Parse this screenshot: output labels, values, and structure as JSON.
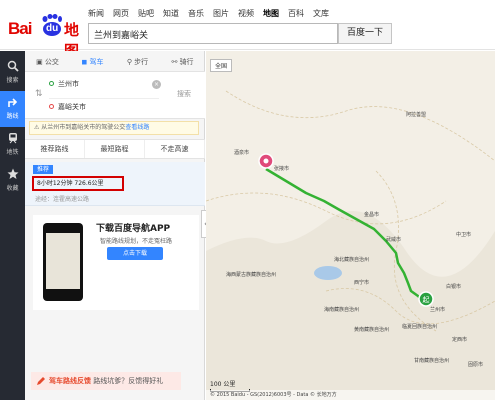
{
  "header": {
    "logo_bai": "Bai",
    "logo_du": "du",
    "logo_map": "地图",
    "nav": [
      "新闻",
      "网页",
      "贴吧",
      "知道",
      "音乐",
      "图片",
      "视频",
      "地图",
      "百科",
      "文库"
    ],
    "search_value": "兰州到嘉峪关",
    "search_button": "百度一下"
  },
  "sidebar": {
    "items": [
      {
        "label": "搜索",
        "icon": "search-icon"
      },
      {
        "label": "路线",
        "icon": "route-icon"
      },
      {
        "label": "地铁",
        "icon": "subway-icon"
      },
      {
        "label": "收藏",
        "icon": "star-icon"
      }
    ]
  },
  "panel": {
    "modes": [
      "公交",
      "驾车",
      "步行",
      "骑行"
    ],
    "start": "兰州市",
    "end": "嘉峪关市",
    "search_link": "搜索",
    "tip_text": "从兰州市到嘉峪关市的驾驶公交",
    "tip_link": "查看线路",
    "options": [
      "推荐路线",
      "最短路程",
      "不走高速"
    ],
    "result_badge": "推荐",
    "duration": "8小时12分钟",
    "distance": "726.6公里",
    "via": "途经：连霍高速公路"
  },
  "ad": {
    "title": "下载百度导航APP",
    "subtitle": "智能路线规划，不走冤枉路",
    "button": "点击下载"
  },
  "feedback": {
    "label": "驾车路线反馈",
    "text": "路线坑爹？反馈得好礼"
  },
  "map": {
    "full_button": "全国",
    "scale": "100 公里",
    "copyright": "© 2015 Baidu - GS(2012)6003号 - Data © 长地万方",
    "labels": [
      "张掖市",
      "酒泉市",
      "金昌市",
      "武威市",
      "西宁市",
      "兰州市",
      "白银市",
      "定西市",
      "海北藏族自治州",
      "海南藏族自治州",
      "黄南藏族自治州",
      "海西蒙古族藏族自治州",
      "临夏回族自治州",
      "甘南藏族自治州",
      "中卫市",
      "固原市",
      "阿拉善盟"
    ],
    "start_marker": "起",
    "end_marker": "终"
  }
}
